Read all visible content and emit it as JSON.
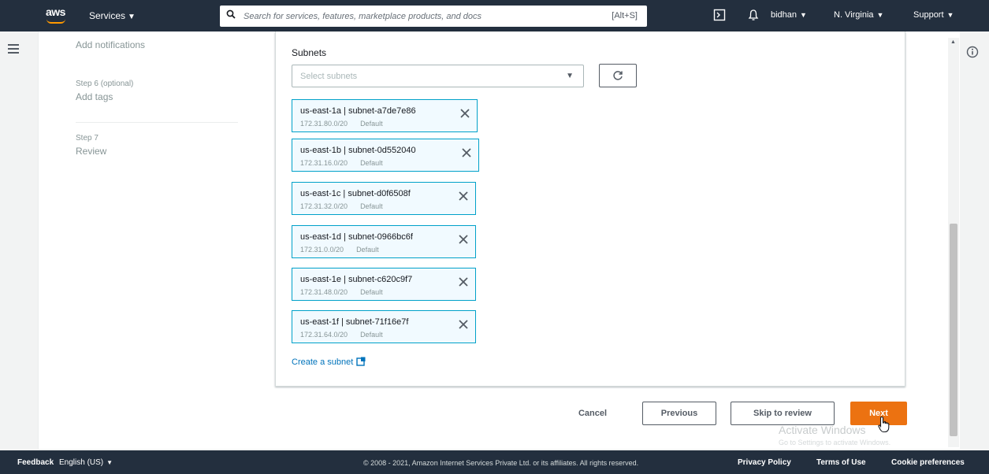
{
  "topnav": {
    "logo_text": "aws",
    "services_label": "Services",
    "search_placeholder": "Search for services, features, marketplace products, and docs",
    "search_shortcut": "[Alt+S]",
    "user": "bidhan",
    "region": "N. Virginia",
    "support": "Support",
    "colors": {
      "bg": "#232f3e",
      "accent": "#ff9900"
    }
  },
  "steps": [
    {
      "label": "",
      "title": "Add notifications"
    },
    {
      "label": "Step 6 (optional)",
      "title": "Add tags"
    },
    {
      "label": "Step 7",
      "title": "Review"
    }
  ],
  "form": {
    "subnets_label": "Subnets",
    "select_placeholder": "Select subnets",
    "subnets": [
      {
        "title": "us-east-1a | subnet-a7de7e86",
        "cidr": "172.31.80.0/20",
        "tag": "Default"
      },
      {
        "title": "us-east-1b | subnet-0d552040",
        "cidr": "172.31.16.0/20",
        "tag": "Default"
      },
      {
        "title": "us-east-1c | subnet-d0f6508f",
        "cidr": "172.31.32.0/20",
        "tag": "Default"
      },
      {
        "title": "us-east-1d | subnet-0966bc6f",
        "cidr": "172.31.0.0/20",
        "tag": "Default"
      },
      {
        "title": "us-east-1e | subnet-c620c9f7",
        "cidr": "172.31.48.0/20",
        "tag": "Default"
      },
      {
        "title": "us-east-1f | subnet-71f16e7f",
        "cidr": "172.31.64.0/20",
        "tag": "Default"
      }
    ],
    "create_subnet_link": "Create a subnet"
  },
  "actions": {
    "cancel": "Cancel",
    "previous": "Previous",
    "skip": "Skip to review",
    "next": "Next",
    "primary_color": "#ec7211"
  },
  "watermark": {
    "title": "Activate Windows",
    "subtitle": "Go to Settings to activate Windows."
  },
  "footer": {
    "feedback": "Feedback",
    "language": "English (US)",
    "copyright": "© 2008 - 2021, Amazon Internet Services Private Ltd. or its affiliates. All rights reserved.",
    "privacy": "Privacy Policy",
    "terms": "Terms of Use",
    "cookies": "Cookie preferences"
  }
}
